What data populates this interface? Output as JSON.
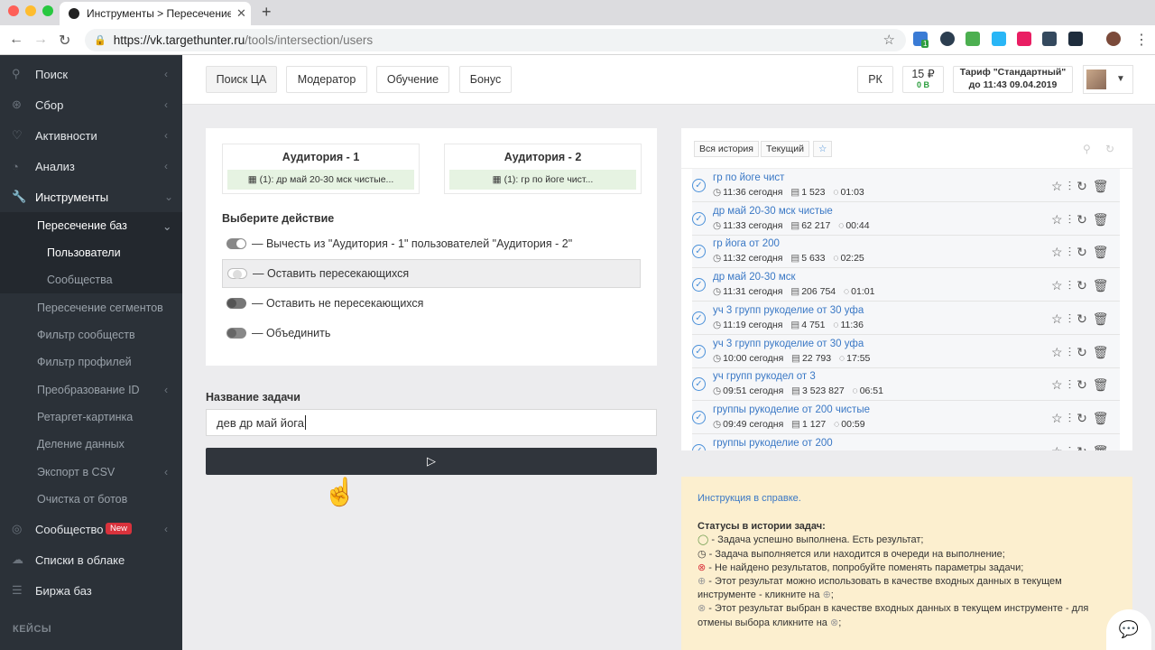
{
  "browser": {
    "tab_title": "Инструменты > Пересечение",
    "tab_close": "✕",
    "new_tab": "+",
    "url_host": "https://vk.targethunter.ru",
    "url_path": "/tools/intersection/users",
    "ext_badge": "1"
  },
  "sidebar": {
    "items": [
      {
        "label": "Поиск",
        "icon": "search-icon"
      },
      {
        "label": "Сбор",
        "icon": "collect-icon"
      },
      {
        "label": "Активности",
        "icon": "heart-icon"
      },
      {
        "label": "Анализ",
        "icon": "analysis-icon"
      },
      {
        "label": "Инструменты",
        "icon": "wrench-icon"
      }
    ],
    "tools_sub": [
      {
        "label": "Пересечение баз"
      },
      {
        "label": "Пользователи"
      },
      {
        "label": "Сообщества"
      },
      {
        "label": "Пересечение сегментов"
      },
      {
        "label": "Фильтр сообществ"
      },
      {
        "label": "Фильтр профилей"
      },
      {
        "label": "Преобразование ID"
      },
      {
        "label": "Ретаргет-картинка"
      },
      {
        "label": "Деление данных"
      },
      {
        "label": "Экспорт в CSV"
      },
      {
        "label": "Очистка от ботов"
      }
    ],
    "bottom": [
      {
        "label": "Сообщество",
        "badge": "New"
      },
      {
        "label": "Списки в облаке"
      },
      {
        "label": "Биржа баз"
      }
    ],
    "cases": "КЕЙСЫ"
  },
  "topbar": {
    "buttons": [
      "Поиск ЦА",
      "Модератор",
      "Обучение",
      "Бонус"
    ],
    "rk": "РК",
    "balance": "15 ₽",
    "balance_sub": "0 В",
    "tarif": "Тариф \"Стандартный\"",
    "tarif_until": "до 11:43 09.04.2019"
  },
  "intersection": {
    "aud1_title": "Аудитория - 1",
    "aud1_value": "(1): др май 20-30 мск чистые...",
    "aud2_title": "Аудитория - 2",
    "aud2_value": "(1): гр по йоге чист...",
    "action_header": "Выберите действие",
    "options": [
      "— Вычесть из \"Аудитория - 1\" пользователей \"Аудитория - 2\"",
      "— Оставить пересекающихся",
      "— Оставить не пересекающихся",
      "— Объединить"
    ],
    "selected_option": 1
  },
  "task": {
    "label": "Название задачи",
    "value": "дев др май йога",
    "run_icon": "play-icon"
  },
  "history": {
    "tabs": [
      "Вся история",
      "Текущий"
    ],
    "rows": [
      {
        "name": "гр по йоге чист",
        "time": "11:36 сегодня",
        "count": "1 523",
        "dur": "01:03"
      },
      {
        "name": "др май 20-30 мск чистые",
        "time": "11:33 сегодня",
        "count": "62 217",
        "dur": "00:44"
      },
      {
        "name": "гр йога от 200",
        "time": "11:32 сегодня",
        "count": "5 633",
        "dur": "02:25"
      },
      {
        "name": "др май 20-30 мск",
        "time": "11:31 сегодня",
        "count": "206 754",
        "dur": "01:01"
      },
      {
        "name": "уч 3 групп рукоделие от 30 уфа",
        "time": "11:19 сегодня",
        "count": "4 751",
        "dur": "11:36"
      },
      {
        "name": "уч 3 групп рукоделие от 30 уфа",
        "time": "10:00 сегодня",
        "count": "22 793",
        "dur": "17:55"
      },
      {
        "name": "уч групп рукодел от 3",
        "time": "09:51 сегодня",
        "count": "3 523 827",
        "dur": "06:51"
      },
      {
        "name": "группы рукоделие от 200 чистые",
        "time": "09:49 сегодня",
        "count": "1 127",
        "dur": "00:59"
      },
      {
        "name": "группы рукоделие от 200",
        "time": "",
        "count": "",
        "dur": ""
      }
    ]
  },
  "help": {
    "link": "Инструкция в справке.",
    "title": "Статусы в истории задач:",
    "lines": [
      "- Задача успешно выполнена. Есть результат;",
      "- Задача выполняется или находится в очереди на выполнение;",
      "- Не найдено результатов, попробуйте поменять параметры задачи;",
      "- Этот результат можно использовать в качестве входных данных в текущем инструменте - кликните на",
      "- Этот результат выбран в качестве входных данных в текущем инструменте - для отмены выбора кликните на"
    ]
  },
  "colors": {
    "sidebar_bg": "#2b3138",
    "accent_link": "#3a78c5",
    "help_bg": "#fcefcf",
    "run_button": "#30353c",
    "badge_red": "#d9323c"
  }
}
